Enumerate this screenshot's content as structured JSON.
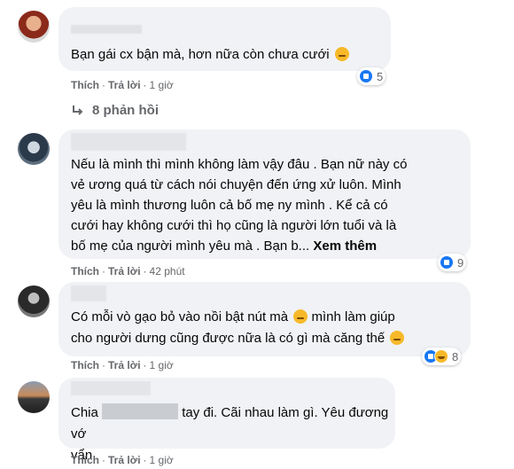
{
  "comments": [
    {
      "text": "Bạn gái cx bận mà, hơn nữa còn chưa cưới",
      "like_label": "Thích",
      "reply_label": "Trả lời",
      "time": "1 giờ",
      "reaction_count": "5",
      "replies_label": "8 phản hồi"
    },
    {
      "text": "Nếu là mình thì mình không làm vậy đâu . Bạn nữ này có\nvẻ ương quá từ cách nói chuyện đến ứng xử luôn. Mình\nyêu là mình thương luôn cả bố mẹ ny mình . Kể cả có\ncưới hay không cưới thì họ cũng là người lớn tuổi và là\nbố mẹ của người mình yêu mà . Bạn b...",
      "see_more": "Xem thêm",
      "like_label": "Thích",
      "reply_label": "Trả lời",
      "time": "42 phút",
      "reaction_count": "9"
    },
    {
      "line1_a": "Có mỗi vò gạo bỏ vào nồi bật nút mà",
      "line1_b": "mình làm giúp",
      "line2": "cho người dưng cũng được nữa là có gì mà căng thế",
      "like_label": "Thích",
      "reply_label": "Trả lời",
      "time": "1 giờ",
      "reaction_count": "8"
    },
    {
      "line1_a": "Chia",
      "line1_b": "tay đi. Cãi nhau làm gì. Yêu đương vớ",
      "line2": "vẩn",
      "like_label": "Thích",
      "reply_label": "Trả lời",
      "time": "1 giờ"
    }
  ],
  "colors": {
    "bubble": "#f0f2f5",
    "meta": "#65676b",
    "like": "#1877f2",
    "haha": "#f7b928"
  }
}
